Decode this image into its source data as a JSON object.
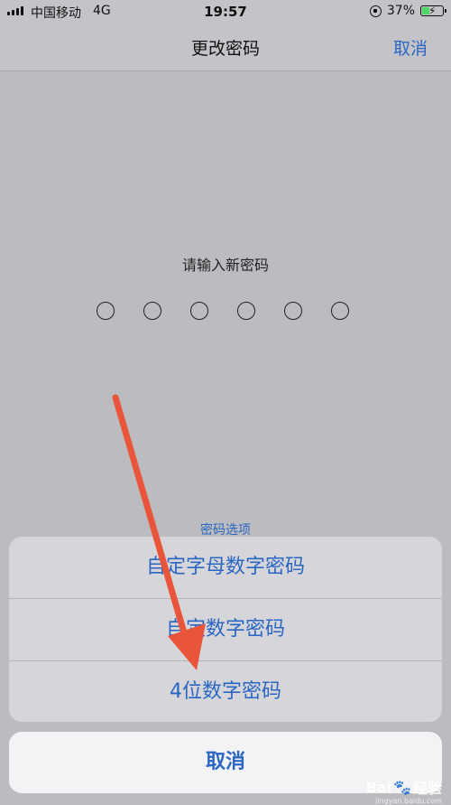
{
  "status_bar": {
    "carrier": "中国移动",
    "network": "4G",
    "time": "19:57",
    "battery_percent": "37%",
    "battery_level": 0.37,
    "icons": [
      "signal-icon",
      "rotation-lock-icon",
      "battery-charging-icon"
    ]
  },
  "nav": {
    "title": "更改密码",
    "cancel_label": "取消"
  },
  "passcode": {
    "prompt": "请输入新密码",
    "digit_count": 6,
    "filled_count": 0
  },
  "action_sheet": {
    "title": "密码选项",
    "options": [
      {
        "label": "自定字母数字密码"
      },
      {
        "label": "自定数字密码"
      },
      {
        "label": "4位数字密码"
      }
    ],
    "cancel_label": "取消"
  },
  "annotation": {
    "arrow_color": "#e8553a",
    "points_to": "4位数字密码"
  },
  "colors": {
    "accent": "#2a66c2",
    "background": "#bcbcc0"
  },
  "watermark": {
    "brand": "Bai",
    "brand_suffix": "经验",
    "url": "jingyan.baidu.com"
  }
}
